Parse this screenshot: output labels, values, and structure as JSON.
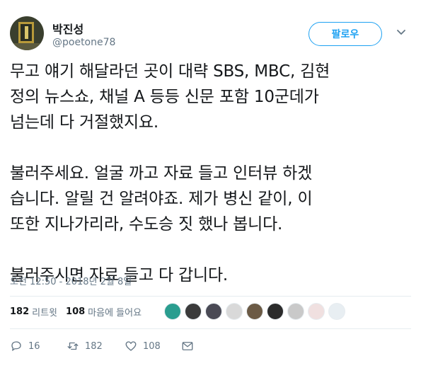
{
  "user": {
    "display_name": "박진성",
    "handle": "@poetone78",
    "avatar_icon": "avatar-image"
  },
  "follow_button": {
    "label": "팔로우"
  },
  "tweet": {
    "text": "무고 얘기 해달라던 곳이 대략 SBS, MBC, 김현\n정의 뉴스쇼, 채널 A 등등 신문 포함 10군데가\n넘는데 다 거절했지요.\n\n불러주세요. 얼굴 까고 자료 들고 인터뷰 하겠\n습니다. 알릴 건 알려야죠. 제가 병신 같이, 이\n또한 지나가리라, 수도승 짓 했나 봅니다.\n\n불러주시면 자료 들고 다 갑니다.",
    "timestamp": "오전 12:50 - 2018년 2월 8일"
  },
  "stats": {
    "retweets_count": "182",
    "retweets_label": "리트윗",
    "likes_count": "108",
    "likes_label": "마음에 들어요"
  },
  "actions": {
    "reply_count": "16",
    "retweet_count": "182",
    "like_count": "108"
  },
  "colors": {
    "accent": "#1da1f2",
    "secondary_text": "#657786",
    "divider": "#e6ecf0"
  }
}
